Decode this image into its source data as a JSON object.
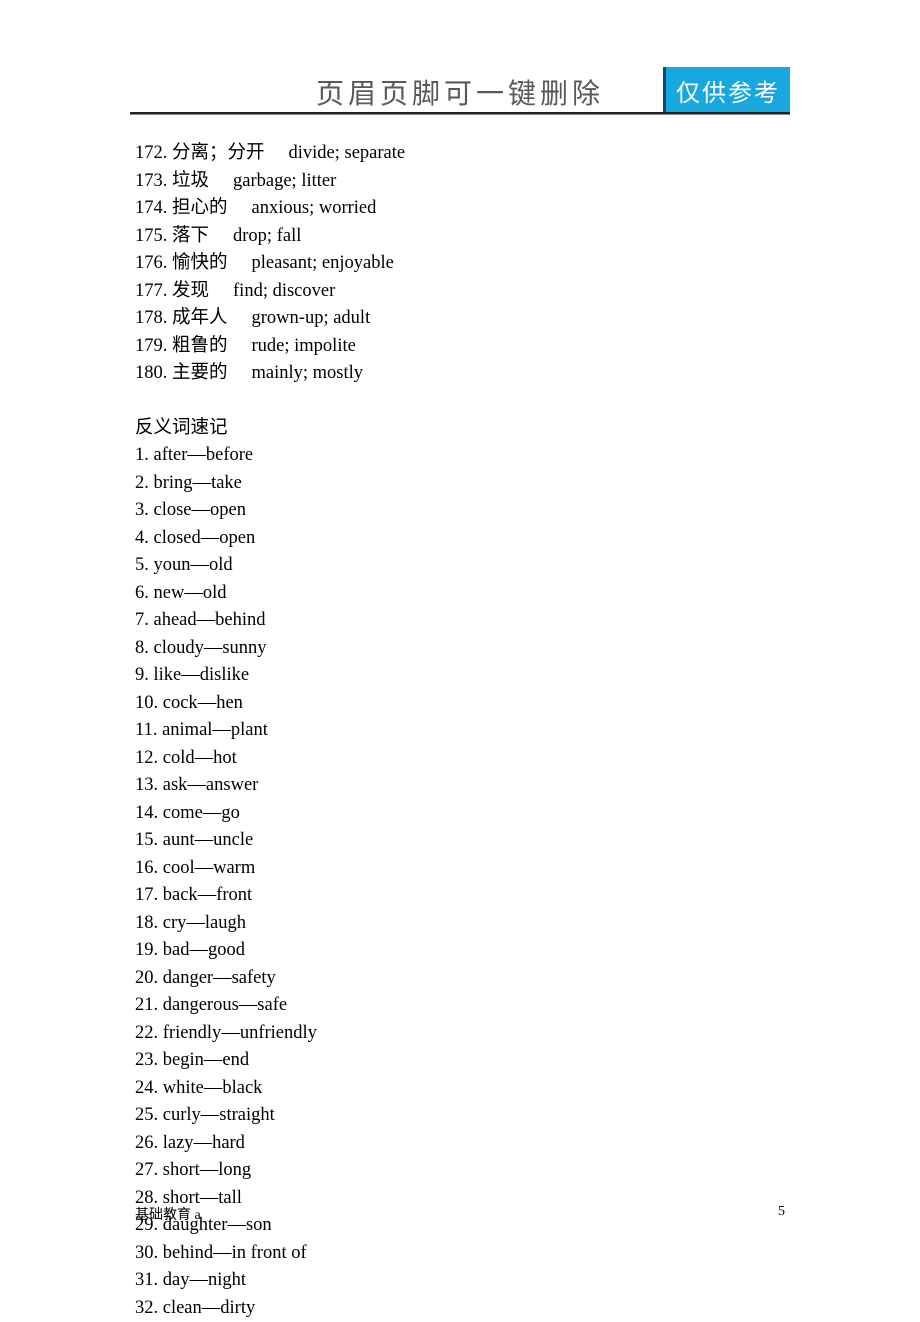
{
  "header": {
    "title": "页眉页脚可一键删除",
    "badge": "仅供参考"
  },
  "synonyms": [
    {
      "num": "172.",
      "cn": "分离；分开",
      "en": "divide; separate"
    },
    {
      "num": "173.",
      "cn": "垃圾",
      "en": "garbage; litter"
    },
    {
      "num": "174.",
      "cn": "担心的",
      "en": "anxious; worried"
    },
    {
      "num": "175.",
      "cn": "落下",
      "en": "drop; fall"
    },
    {
      "num": "176.",
      "cn": "愉快的",
      "en": "pleasant; enjoyable"
    },
    {
      "num": "177.",
      "cn": "发现",
      "en": "find; discover"
    },
    {
      "num": "178.",
      "cn": "成年人",
      "en": "grown-up; adult"
    },
    {
      "num": "179.",
      "cn": "粗鲁的",
      "en": "rude; impolite"
    },
    {
      "num": "180.",
      "cn": "主要的",
      "en": "mainly; mostly"
    }
  ],
  "sectionTitle": "反义词速记",
  "antonyms": [
    {
      "num": "1.",
      "a": "after",
      "b": "before"
    },
    {
      "num": "2.",
      "a": "bring",
      "b": "take"
    },
    {
      "num": "3.",
      "a": "close",
      "b": "open"
    },
    {
      "num": "4.",
      "a": "closed",
      "b": "open"
    },
    {
      "num": "5.",
      "a": "youn",
      "b": "old"
    },
    {
      "num": "6.",
      "a": "new",
      "b": "old"
    },
    {
      "num": "7.",
      "a": "ahead",
      "b": "behind"
    },
    {
      "num": "8.",
      "a": "cloudy",
      "b": "sunny"
    },
    {
      "num": "9.",
      "a": "like",
      "b": "dislike"
    },
    {
      "num": "10.",
      "a": "cock",
      "b": "hen"
    },
    {
      "num": "11.",
      "a": "animal",
      "b": "plant"
    },
    {
      "num": "12.",
      "a": "cold",
      "b": "hot"
    },
    {
      "num": "13.",
      "a": "ask",
      "b": "answer"
    },
    {
      "num": "14.",
      "a": "come",
      "b": "go"
    },
    {
      "num": "15.",
      "a": "aunt",
      "b": "uncle"
    },
    {
      "num": "16.",
      "a": "cool",
      "b": "warm"
    },
    {
      "num": "17.",
      "a": "back",
      "b": "front"
    },
    {
      "num": "18.",
      "a": "cry",
      "b": "laugh"
    },
    {
      "num": "19.",
      "a": "bad",
      "b": "good"
    },
    {
      "num": "20.",
      "a": "danger",
      "b": "safety"
    },
    {
      "num": "21.",
      "a": "dangerous",
      "b": "safe"
    },
    {
      "num": "22.",
      "a": "friendly",
      "b": "unfriendly"
    },
    {
      "num": "23.",
      "a": "begin",
      "b": "end"
    },
    {
      "num": "24.",
      "a": "white",
      "b": "black"
    },
    {
      "num": "25.",
      "a": "curly",
      "b": "straight"
    },
    {
      "num": "26.",
      "a": "lazy",
      "b": "hard"
    },
    {
      "num": "27.",
      "a": "short",
      "b": "long"
    },
    {
      "num": "28.",
      "a": "short",
      "b": "tall"
    },
    {
      "num": "29.",
      "a": "daughter",
      "b": "son"
    },
    {
      "num": "30.",
      "a": "behind",
      "b": "in front of"
    },
    {
      "num": "31.",
      "a": "day",
      "b": "night"
    },
    {
      "num": "32.",
      "a": "clean",
      "b": "dirty"
    }
  ],
  "footer": {
    "left": "基础教育 a",
    "right": "5"
  }
}
